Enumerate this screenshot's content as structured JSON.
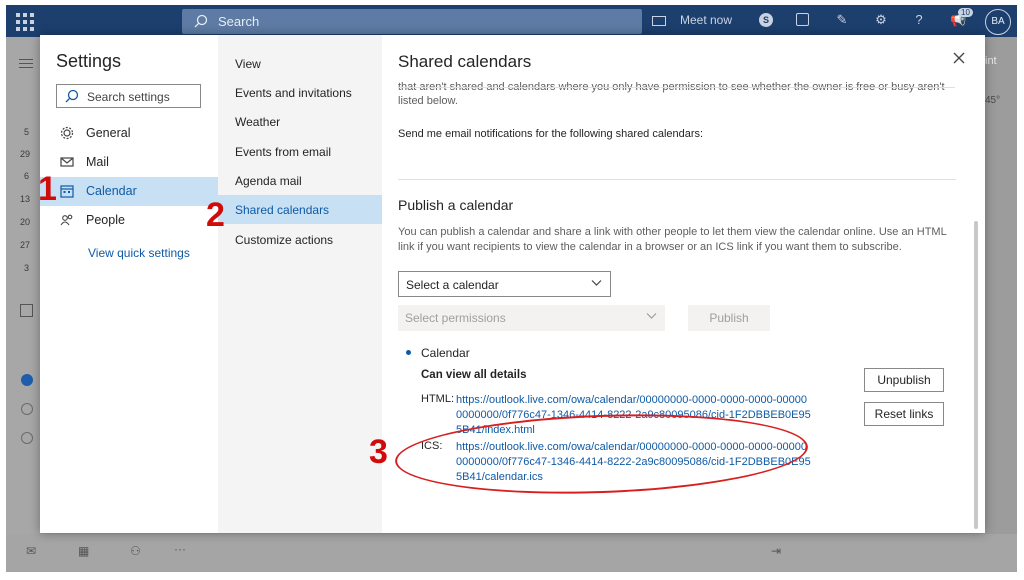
{
  "topbar": {
    "search_placeholder": "Search",
    "meet_now": "Meet now",
    "notification_count": "10",
    "avatar_initials": "BA"
  },
  "background": {
    "calendar_dates": [
      "5",
      "29",
      "6",
      "13",
      "20",
      "27",
      "3"
    ],
    "right_label": "int",
    "weather": "45°"
  },
  "settings": {
    "title": "Settings",
    "search_placeholder": "Search settings",
    "nav": [
      {
        "label": "General",
        "icon": "gear-icon"
      },
      {
        "label": "Mail",
        "icon": "mail-icon"
      },
      {
        "label": "Calendar",
        "icon": "calendar-icon",
        "selected": true
      },
      {
        "label": "People",
        "icon": "people-icon"
      }
    ],
    "view_quick_settings": "View quick settings"
  },
  "subnav": {
    "items": [
      {
        "label": "View"
      },
      {
        "label": "Events and invitations"
      },
      {
        "label": "Weather"
      },
      {
        "label": "Events from email"
      },
      {
        "label": "Agenda mail"
      },
      {
        "label": "Shared calendars",
        "selected": true
      },
      {
        "label": "Customize actions"
      }
    ]
  },
  "shared": {
    "title": "Shared calendars",
    "cut_text": "that aren't shared and calendars where you only have permission to see whether the owner is free or busy aren't listed below.",
    "notification_text": "Send me email notifications for the following shared calendars:",
    "publish_heading": "Publish a calendar",
    "publish_description": "You can publish a calendar and share a link with other people to let them view the calendar online. Use an HTML link if you want recipients to view the calendar in a browser or an ICS link if you want them to subscribe.",
    "select_calendar_placeholder": "Select a calendar",
    "select_permissions_placeholder": "Select permissions",
    "publish_button": "Publish",
    "calendar_name": "Calendar",
    "permission_level": "Can view all details",
    "html_label": "HTML:",
    "html_link": "https://outlook.live.com/owa/calendar/00000000-0000-0000-0000-000000000000/0f776c47-1346-4414-8222-2a9c80095086/cid-1F2DBBEB0E955B41/index.html",
    "ics_label": "ICS:",
    "ics_link": "https://outlook.live.com/owa/calendar/00000000-0000-0000-0000-000000000000/0f776c47-1346-4414-8222-2a9c80095086/cid-1F2DBBEB0E955B41/calendar.ics",
    "unpublish_button": "Unpublish",
    "reset_links_button": "Reset links"
  },
  "annotations": {
    "step1": "1",
    "step2": "2",
    "step3": "3",
    "color": "#d10a0a"
  }
}
